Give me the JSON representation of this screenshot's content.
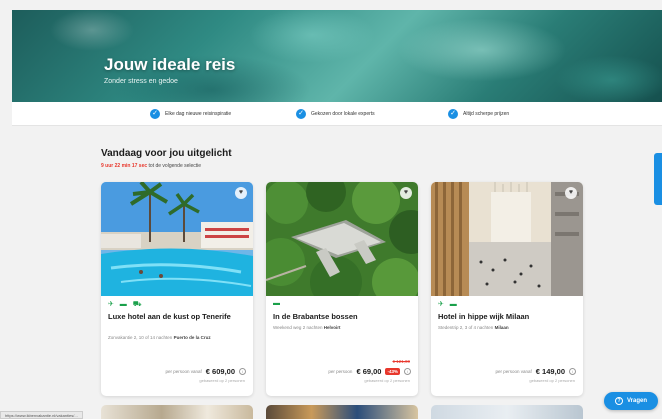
{
  "hero": {
    "title": "Jouw ideale reis",
    "subtitle": "Zonder stress en gedoe"
  },
  "benefits": [
    {
      "label": "Elke dag nieuwe reisinspiratie",
      "icon": "check-circle-icon"
    },
    {
      "label": "Gekozen door lokale experts",
      "icon": "check-circle-icon"
    },
    {
      "label": "Altijd scherpe prijzen",
      "icon": "check-circle-icon"
    }
  ],
  "section": {
    "title": "Vandaag voor jou uitgelicht",
    "countdown_timer": "9 uur 22 min 17 sec",
    "countdown_rest": "tot de volgende selectie"
  },
  "cards": [
    {
      "title": "Luxe hotel aan de kust op Tenerife",
      "meta_prefix": "Zonvakantie",
      "meta_middle": "2, 10 of 14 nachten",
      "meta_place": "Puerto de la Cruz",
      "old_price": "",
      "discount": "",
      "price_label": "per persoon vanaf",
      "price": "€ 609,00",
      "price_note": "gebaseerd op 2 personen",
      "amenities": "✈ ▬ ⛟"
    },
    {
      "title": "In de Brabantse bossen",
      "meta_prefix": "Weekend weg",
      "meta_middle": "2 nachten",
      "meta_place": "Helvoirt",
      "old_price": "€ 121,00",
      "discount": "-43%",
      "price_label": "per persoon",
      "price": "€ 69,00",
      "price_note": "gebaseerd op 2 personen",
      "amenities": "▬"
    },
    {
      "title": "Hotel in hippe wijk Milaan",
      "meta_prefix": "Stedentrip",
      "meta_middle": "2, 3 of 4 nachten",
      "meta_place": "Milaan",
      "old_price": "",
      "discount": "",
      "price_label": "per persoon vanaf",
      "price": "€ 149,00",
      "price_note": "gebaseerd op 2 personen",
      "amenities": "✈ ▬"
    }
  ],
  "help_button": {
    "label": "Vragen"
  },
  "status_url": "https://www.ikbenvakantie.nl/vakanties/...",
  "colors": {
    "accent": "#1a8fe3",
    "alert": "#e8372c",
    "amenity": "#1aa04a"
  }
}
